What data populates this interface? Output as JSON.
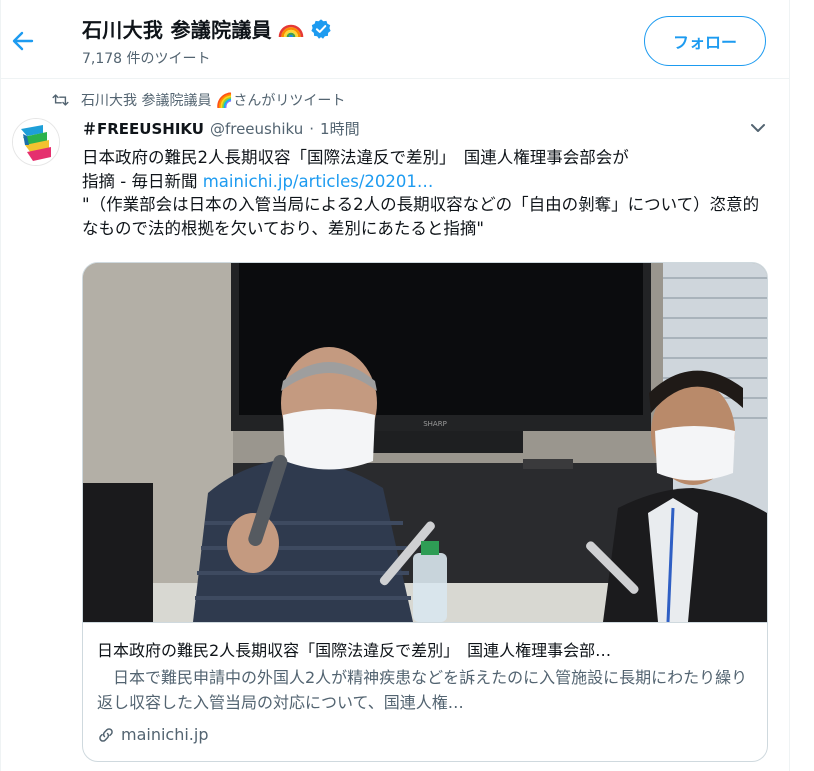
{
  "header": {
    "name": "石川大我 参議院議員",
    "tweet_count": "7,178 件のツイート",
    "follow_label": "フォロー"
  },
  "retweet": {
    "text": "石川大我 参議院議員 🌈さんがリツイート"
  },
  "tweet": {
    "display_name": "＃FREEUSHIKU",
    "handle": "@freeushiku",
    "separator": "·",
    "time": "1時間",
    "text_line1": "日本政府の難民2人長期収容「国際法違反で差別」　国連人権理事会部会が",
    "text_line2_prefix": "指摘 - 毎日新聞 ",
    "link_text": "mainichi.jp/articles/20201…",
    "quote": "\"（作業部会は日本の入管当局による2人の長期収容などの「自由の剝奪」について）恣意的なもので法的根拠を欠いており、差別にあたると指摘\""
  },
  "card": {
    "title": "日本政府の難民2人長期収容「国際法違反で差別」　国連人権理事会部…",
    "description": "　日本で難民申請中の外国人2人が精神疾患などを訴えたのに入管施設に長期にわたり繰り返し収容した入管当局の対応について、国連人権…",
    "domain": "mainichi.jp",
    "tv_brand": "SHARP"
  },
  "colors": {
    "accent": "#1d9bf0",
    "secondary_text": "#536471",
    "border": "#cfd9de"
  },
  "icons": {
    "back": "arrow-left-icon",
    "verified": "verified-badge-icon",
    "rainbow": "rainbow-emoji",
    "retweet": "retweet-icon",
    "caret": "chevron-down-icon",
    "link": "link-icon"
  }
}
